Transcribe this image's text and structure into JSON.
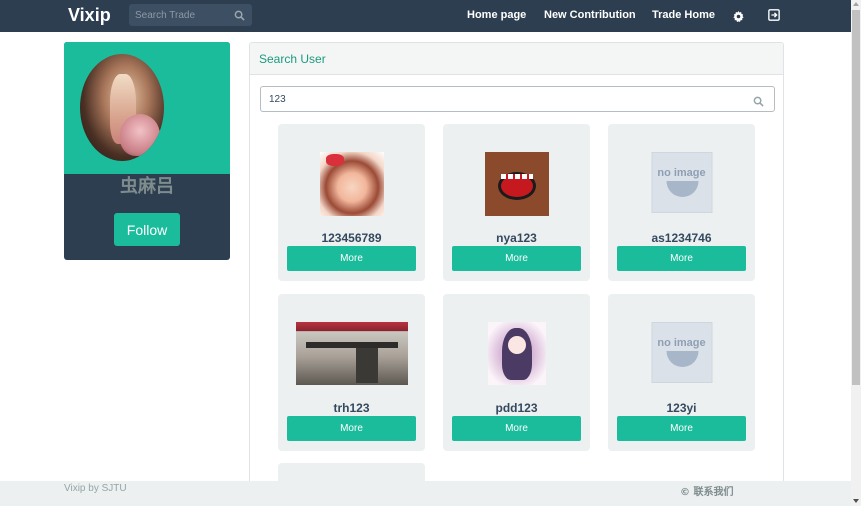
{
  "navbar": {
    "brand": "Vixip",
    "search_placeholder": "Search Trade",
    "links": [
      "Home page",
      "New Contribution",
      "Trade Home"
    ],
    "icons": [
      "gear-icon",
      "logout-icon"
    ]
  },
  "profile": {
    "username": "虫麻吕",
    "follow_label": "Follow"
  },
  "panel": {
    "title": "Search User",
    "search_value": "123"
  },
  "results": [
    {
      "name": "123456789",
      "more": "More",
      "image": "anime-avatar"
    },
    {
      "name": "nya123",
      "more": "More",
      "image": "domo-avatar"
    },
    {
      "name": "as1234746",
      "more": "More",
      "image": "no-image"
    },
    {
      "name": "trh123",
      "more": "More",
      "image": "photo-avatar"
    },
    {
      "name": "pdd123",
      "more": "More",
      "image": "anime-avatar"
    },
    {
      "name": "123yi",
      "more": "More",
      "image": "no-image"
    }
  ],
  "no_image_text": "no image",
  "footer": {
    "left": "Vixip by SJTU",
    "right": "© 联系我们"
  },
  "colors": {
    "navbar": "#2c3e50",
    "accent": "#1abc9c",
    "card": "#ecf0f1"
  }
}
